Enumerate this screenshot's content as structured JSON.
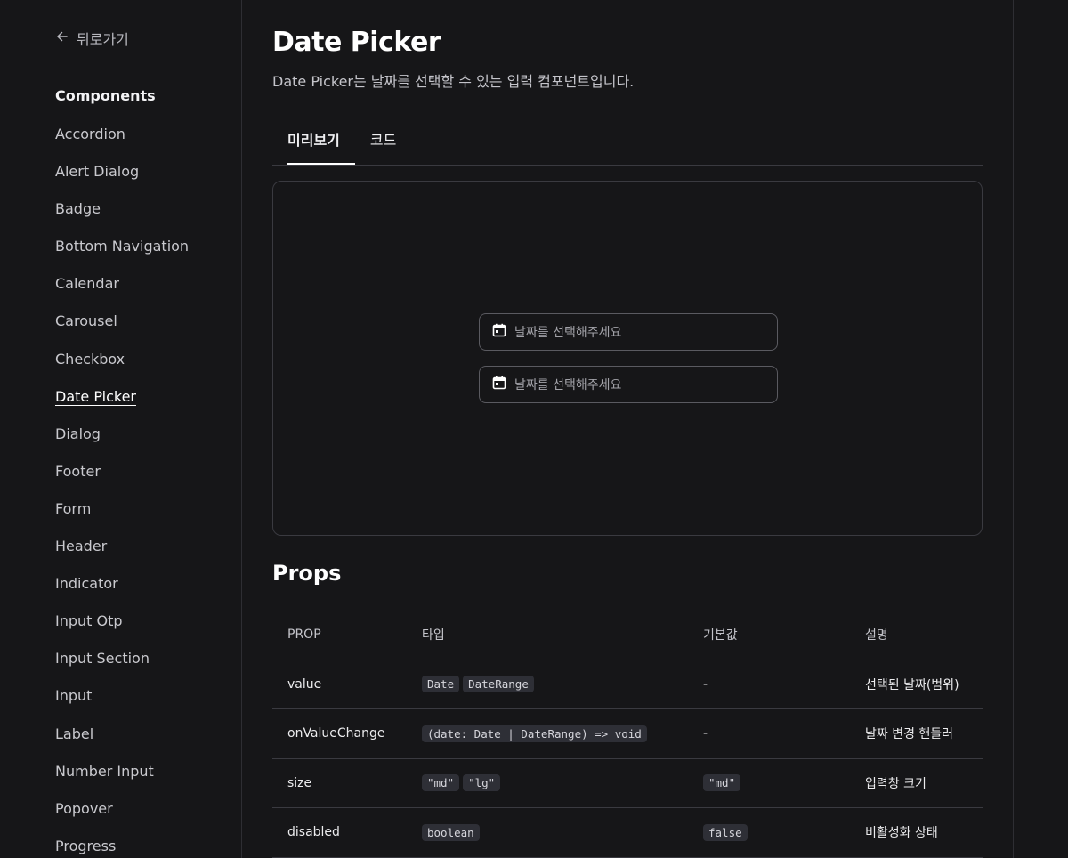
{
  "sidebar": {
    "back_label": "뒤로가기",
    "section_title": "Components",
    "items": [
      {
        "label": "Accordion"
      },
      {
        "label": "Alert Dialog"
      },
      {
        "label": "Badge"
      },
      {
        "label": "Bottom Navigation"
      },
      {
        "label": "Calendar"
      },
      {
        "label": "Carousel"
      },
      {
        "label": "Checkbox"
      },
      {
        "label": "Date Picker",
        "active": true
      },
      {
        "label": "Dialog"
      },
      {
        "label": "Footer"
      },
      {
        "label": "Form"
      },
      {
        "label": "Header"
      },
      {
        "label": "Indicator"
      },
      {
        "label": "Input Otp"
      },
      {
        "label": "Input Section"
      },
      {
        "label": "Input"
      },
      {
        "label": "Label"
      },
      {
        "label": "Number Input"
      },
      {
        "label": "Popover"
      },
      {
        "label": "Progress"
      }
    ]
  },
  "main": {
    "title": "Date Picker",
    "description": "Date Picker는 날짜를 선택할 수 있는 입력 컴포넌트입니다.",
    "tabs": [
      {
        "label": "미리보기",
        "active": true
      },
      {
        "label": "코드",
        "active": false
      }
    ],
    "preview": {
      "inputs": [
        {
          "placeholder": "날짜를 선택해주세요",
          "icon": "calendar-icon"
        },
        {
          "placeholder": "날짜를 선택해주세요",
          "icon": "calendar-icon"
        }
      ]
    },
    "props_title": "Props",
    "props_table": {
      "headers": [
        "PROP",
        "타입",
        "기본값",
        "설명"
      ],
      "rows": [
        {
          "prop": "value",
          "types": [
            "Date",
            "DateRange"
          ],
          "default": "-",
          "default_code": false,
          "description": "선택된 날짜(범위)"
        },
        {
          "prop": "onValueChange",
          "types": [
            "(date: Date | DateRange) => void"
          ],
          "default": "-",
          "default_code": false,
          "description": "날짜 변경 핸들러"
        },
        {
          "prop": "size",
          "types": [
            "\"md\"",
            "\"lg\""
          ],
          "default": "\"md\"",
          "default_code": true,
          "description": "입력창 크기"
        },
        {
          "prop": "disabled",
          "types": [
            "boolean"
          ],
          "default": "false",
          "default_code": true,
          "description": "비활성화 상태"
        }
      ]
    }
  },
  "colors": {
    "background": "#161618",
    "border": "#3a3a40",
    "code_bg": "#2e2f36",
    "text": "#ececee"
  }
}
